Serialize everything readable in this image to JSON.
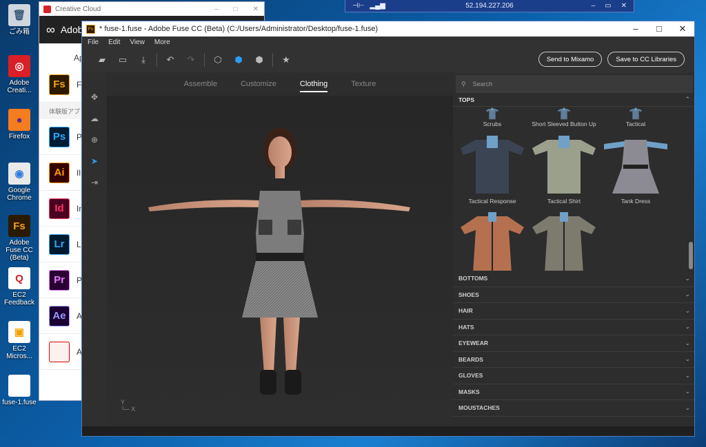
{
  "desktop": {
    "icons": [
      {
        "label": "ごみ箱",
        "glyph": "🗑",
        "icon": "recycle-bin-icon",
        "color": "#cfd6de",
        "fg": "#3a5a7a"
      },
      {
        "label": "Adobe Creati...",
        "glyph": "◎",
        "icon": "creative-cloud-icon",
        "color": "#da1f26",
        "fg": "#ffffff"
      },
      {
        "label": "Firefox",
        "glyph": "●",
        "icon": "firefox-icon",
        "color": "#f57c1f",
        "fg": "#5a2a8a"
      },
      {
        "label": "Google Chrome",
        "glyph": "◉",
        "icon": "chrome-icon",
        "color": "#e9e9e9",
        "fg": "#2f7ce0"
      },
      {
        "label": "Adobe Fuse CC (Beta)",
        "glyph": "Fs",
        "icon": "adobe-fuse-icon",
        "color": "#2b1a00",
        "fg": "#f3a01c"
      },
      {
        "label": "EC2 Feedback",
        "glyph": "Q",
        "icon": "ec2-feedback-icon",
        "color": "#ffffff",
        "fg": "#cc2222"
      },
      {
        "label": "EC2 Micros...",
        "glyph": "▣",
        "icon": "ec2-icon",
        "color": "#ffffff",
        "fg": "#f2a100"
      },
      {
        "label": "fuse-1.fuse",
        "glyph": "",
        "icon": "file-icon",
        "color": "#ffffff",
        "fg": "#ffffff"
      }
    ]
  },
  "rdp": {
    "host": "52.194.227.206"
  },
  "cc_window": {
    "title": "Creative Cloud",
    "brand": "Adob",
    "tab": "Ap",
    "section": "体験版アプ",
    "apps": [
      {
        "abbr": "Fs",
        "name": "F",
        "bg": "#2b1a00",
        "fg": "#f3a01c"
      },
      {
        "abbr": "Ps",
        "name": "P",
        "bg": "#001d34",
        "fg": "#31a8ff"
      },
      {
        "abbr": "Ai",
        "name": "Il",
        "bg": "#330000",
        "fg": "#ff9a00"
      },
      {
        "abbr": "Id",
        "name": "In",
        "bg": "#49021f",
        "fg": "#ff3366"
      },
      {
        "abbr": "Lr",
        "name": "L",
        "bg": "#001a2d",
        "fg": "#31a8ff"
      },
      {
        "abbr": "Pr",
        "name": "P",
        "bg": "#2a0034",
        "fg": "#ea77ff"
      },
      {
        "abbr": "Ae",
        "name": "A",
        "bg": "#1a0033",
        "fg": "#9999ff"
      },
      {
        "abbr": "",
        "name": "A",
        "bg": "#fff0f0",
        "fg": "#d40000"
      }
    ]
  },
  "fuse": {
    "title": "* fuse-1.fuse - Adobe Fuse CC (Beta) (C:/Users/Administrator/Desktop/fuse-1.fuse)",
    "icon_text": "Fs",
    "menu": [
      "File",
      "Edit",
      "View",
      "More"
    ],
    "send_label": "Send to Mixamo",
    "save_label": "Save to CC Libraries",
    "tabs": [
      "Assemble",
      "Customize",
      "Clothing",
      "Texture"
    ],
    "active_tab": "Clothing",
    "axis_y": "Y",
    "axis_x": "X",
    "search_placeholder": "Search",
    "tops_header": "TOPS",
    "tops_partial": [
      "Scrubs",
      "Short Sleeved Button Up",
      "Tactical"
    ],
    "tops_items": [
      "Tactical Response",
      "Tactical Shirt",
      "Tank Dress"
    ],
    "tops_items_2": [
      "",
      ""
    ],
    "categories": [
      "BOTTOMS",
      "SHOES",
      "HAIR",
      "HATS",
      "EYEWEAR",
      "BEARDS",
      "GLOVES",
      "MASKS",
      "MOUSTACHES"
    ],
    "colors": {
      "accent": "#2d9bf0"
    }
  }
}
